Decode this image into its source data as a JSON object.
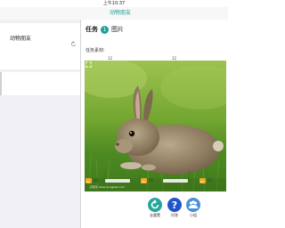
{
  "status_bar": {
    "time": "上午10:37"
  },
  "nav": {
    "title": "动物朋友"
  },
  "sidebar": {
    "title": "动物朋友"
  },
  "task": {
    "label": "任务",
    "number": "1",
    "kind": "图片"
  },
  "material": {
    "label": "任务素材:"
  },
  "image": {
    "counters": [
      "12",
      "12"
    ],
    "watermark": "农家乐 www.nongjiale.com"
  },
  "thumbs": [
    "10",
    "11",
    "12"
  ],
  "actions": [
    {
      "label": "去重置",
      "color": "#26a69a",
      "icon": "refresh-icon"
    },
    {
      "label": "问答",
      "color": "#2255cc",
      "icon": "question-icon"
    },
    {
      "label": "小组",
      "color": "#4a90d9",
      "icon": "group-icon"
    }
  ],
  "colors": {
    "accent": "#1ea09a",
    "thumb": "#f5a623"
  }
}
